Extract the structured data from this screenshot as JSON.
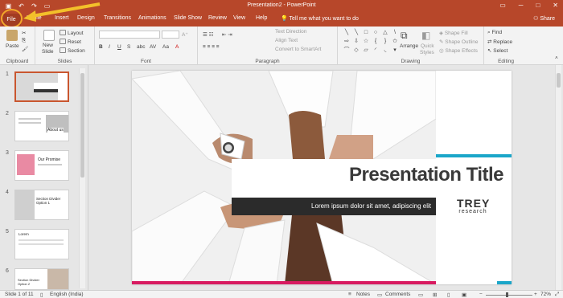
{
  "window": {
    "title": "Presentation2 - PowerPoint",
    "minimize_icon": "minimize-icon",
    "maximize_icon": "maximize-icon",
    "close_icon": "close-icon"
  },
  "quick_access": {
    "save_icon": "save-icon",
    "undo_icon": "undo-icon",
    "redo_icon": "redo-icon",
    "present_icon": "present-from-start-icon"
  },
  "tabs": [
    "File",
    "Home",
    "Insert",
    "Design",
    "Transitions",
    "Animations",
    "Slide Show",
    "Review",
    "View",
    "Help"
  ],
  "tell_me": "Tell me what you want to do",
  "share": "Share",
  "ribbon": {
    "clipboard": {
      "paste": "Paste",
      "label": "Clipboard"
    },
    "slides": {
      "new_slide": "New",
      "new_slide2": "Slide",
      "layout": "Layout",
      "reset": "Reset",
      "section": "Section",
      "label": "Slides"
    },
    "font": {
      "label": "Font",
      "bold": "B",
      "italic": "I",
      "underline": "U",
      "strike": "S",
      "abc": "abc",
      "av": "AV"
    },
    "paragraph": {
      "text_direction": "Text Direction",
      "align_text": "Align Text",
      "smartart": "Convert to SmartArt",
      "label": "Paragraph"
    },
    "drawing": {
      "arrange": "Arrange",
      "quick_styles": "Quick",
      "quick_styles2": "Styles",
      "shape_fill": "Shape Fill",
      "shape_outline": "Shape Outline",
      "shape_effects": "Shape Effects",
      "label": "Drawing"
    },
    "editing": {
      "find": "Find",
      "replace": "Replace",
      "select": "Select",
      "label": "Editing"
    }
  },
  "thumbnails": [
    {
      "num": "1"
    },
    {
      "num": "2",
      "text": "About us"
    },
    {
      "num": "3",
      "text": "Our Promise"
    },
    {
      "num": "4",
      "text": "Section Divider Option 1"
    },
    {
      "num": "5",
      "text": "Lorem"
    },
    {
      "num": "6",
      "text": "Section Divider Option 2"
    }
  ],
  "slide": {
    "title": "Presentation Title",
    "subtitle": "Lorem ipsum dolor sit amet, adipiscing elit",
    "logo_big": "TREY",
    "logo_small": "research"
  },
  "status": {
    "slide": "Slide 1 of 11",
    "language": "English (India)",
    "notes": "Notes",
    "comments": "Comments",
    "zoom": "72%"
  },
  "colors": {
    "accent": "#b7472a",
    "cyan": "#1ba6c9",
    "pink": "#d81b60",
    "highlight": "#f3a82a"
  }
}
